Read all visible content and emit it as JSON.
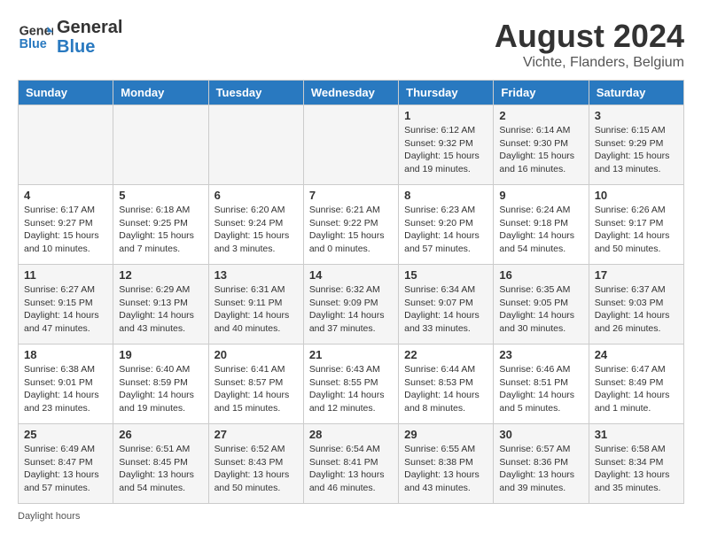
{
  "header": {
    "logo_line1": "General",
    "logo_line2": "Blue",
    "title": "August 2024",
    "subtitle": "Vichte, Flanders, Belgium"
  },
  "days_of_week": [
    "Sunday",
    "Monday",
    "Tuesday",
    "Wednesday",
    "Thursday",
    "Friday",
    "Saturday"
  ],
  "weeks": [
    [
      {
        "day": "",
        "info": ""
      },
      {
        "day": "",
        "info": ""
      },
      {
        "day": "",
        "info": ""
      },
      {
        "day": "",
        "info": ""
      },
      {
        "day": "1",
        "info": "Sunrise: 6:12 AM\nSunset: 9:32 PM\nDaylight: 15 hours and 19 minutes."
      },
      {
        "day": "2",
        "info": "Sunrise: 6:14 AM\nSunset: 9:30 PM\nDaylight: 15 hours and 16 minutes."
      },
      {
        "day": "3",
        "info": "Sunrise: 6:15 AM\nSunset: 9:29 PM\nDaylight: 15 hours and 13 minutes."
      }
    ],
    [
      {
        "day": "4",
        "info": "Sunrise: 6:17 AM\nSunset: 9:27 PM\nDaylight: 15 hours and 10 minutes."
      },
      {
        "day": "5",
        "info": "Sunrise: 6:18 AM\nSunset: 9:25 PM\nDaylight: 15 hours and 7 minutes."
      },
      {
        "day": "6",
        "info": "Sunrise: 6:20 AM\nSunset: 9:24 PM\nDaylight: 15 hours and 3 minutes."
      },
      {
        "day": "7",
        "info": "Sunrise: 6:21 AM\nSunset: 9:22 PM\nDaylight: 15 hours and 0 minutes."
      },
      {
        "day": "8",
        "info": "Sunrise: 6:23 AM\nSunset: 9:20 PM\nDaylight: 14 hours and 57 minutes."
      },
      {
        "day": "9",
        "info": "Sunrise: 6:24 AM\nSunset: 9:18 PM\nDaylight: 14 hours and 54 minutes."
      },
      {
        "day": "10",
        "info": "Sunrise: 6:26 AM\nSunset: 9:17 PM\nDaylight: 14 hours and 50 minutes."
      }
    ],
    [
      {
        "day": "11",
        "info": "Sunrise: 6:27 AM\nSunset: 9:15 PM\nDaylight: 14 hours and 47 minutes."
      },
      {
        "day": "12",
        "info": "Sunrise: 6:29 AM\nSunset: 9:13 PM\nDaylight: 14 hours and 43 minutes."
      },
      {
        "day": "13",
        "info": "Sunrise: 6:31 AM\nSunset: 9:11 PM\nDaylight: 14 hours and 40 minutes."
      },
      {
        "day": "14",
        "info": "Sunrise: 6:32 AM\nSunset: 9:09 PM\nDaylight: 14 hours and 37 minutes."
      },
      {
        "day": "15",
        "info": "Sunrise: 6:34 AM\nSunset: 9:07 PM\nDaylight: 14 hours and 33 minutes."
      },
      {
        "day": "16",
        "info": "Sunrise: 6:35 AM\nSunset: 9:05 PM\nDaylight: 14 hours and 30 minutes."
      },
      {
        "day": "17",
        "info": "Sunrise: 6:37 AM\nSunset: 9:03 PM\nDaylight: 14 hours and 26 minutes."
      }
    ],
    [
      {
        "day": "18",
        "info": "Sunrise: 6:38 AM\nSunset: 9:01 PM\nDaylight: 14 hours and 23 minutes."
      },
      {
        "day": "19",
        "info": "Sunrise: 6:40 AM\nSunset: 8:59 PM\nDaylight: 14 hours and 19 minutes."
      },
      {
        "day": "20",
        "info": "Sunrise: 6:41 AM\nSunset: 8:57 PM\nDaylight: 14 hours and 15 minutes."
      },
      {
        "day": "21",
        "info": "Sunrise: 6:43 AM\nSunset: 8:55 PM\nDaylight: 14 hours and 12 minutes."
      },
      {
        "day": "22",
        "info": "Sunrise: 6:44 AM\nSunset: 8:53 PM\nDaylight: 14 hours and 8 minutes."
      },
      {
        "day": "23",
        "info": "Sunrise: 6:46 AM\nSunset: 8:51 PM\nDaylight: 14 hours and 5 minutes."
      },
      {
        "day": "24",
        "info": "Sunrise: 6:47 AM\nSunset: 8:49 PM\nDaylight: 14 hours and 1 minute."
      }
    ],
    [
      {
        "day": "25",
        "info": "Sunrise: 6:49 AM\nSunset: 8:47 PM\nDaylight: 13 hours and 57 minutes."
      },
      {
        "day": "26",
        "info": "Sunrise: 6:51 AM\nSunset: 8:45 PM\nDaylight: 13 hours and 54 minutes."
      },
      {
        "day": "27",
        "info": "Sunrise: 6:52 AM\nSunset: 8:43 PM\nDaylight: 13 hours and 50 minutes."
      },
      {
        "day": "28",
        "info": "Sunrise: 6:54 AM\nSunset: 8:41 PM\nDaylight: 13 hours and 46 minutes."
      },
      {
        "day": "29",
        "info": "Sunrise: 6:55 AM\nSunset: 8:38 PM\nDaylight: 13 hours and 43 minutes."
      },
      {
        "day": "30",
        "info": "Sunrise: 6:57 AM\nSunset: 8:36 PM\nDaylight: 13 hours and 39 minutes."
      },
      {
        "day": "31",
        "info": "Sunrise: 6:58 AM\nSunset: 8:34 PM\nDaylight: 13 hours and 35 minutes."
      }
    ]
  ],
  "footer": "Daylight hours"
}
